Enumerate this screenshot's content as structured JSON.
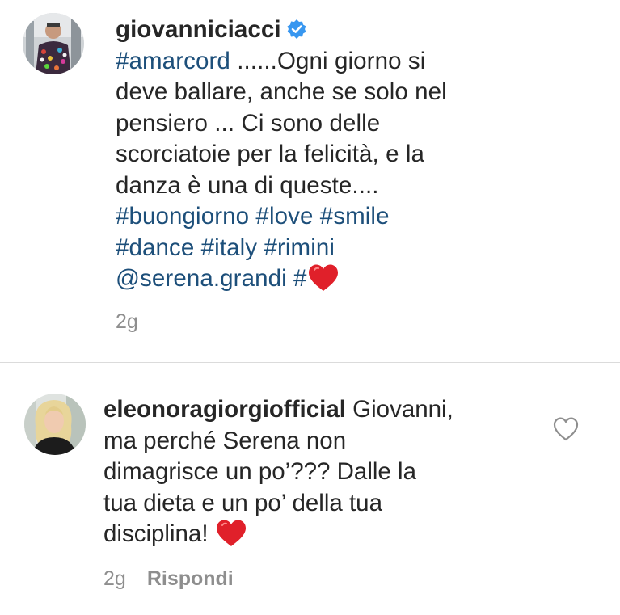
{
  "caption": {
    "username": "giovanniciacci",
    "verified_color": "#3897f0",
    "line1_tag": "#amarcord",
    "line1_rest": " ......Ogni giorno si",
    "line2": "deve ballare, anche se solo nel",
    "line3": "pensiero ... Ci sono delle",
    "line4": "scorciatoie per la felicità, e la",
    "line5": "danza è una di queste....",
    "line6": "#buongiorno #love #smile",
    "line7": "#dance #italy #rimini",
    "line8_mention": "@serena.grandi",
    "line8_tag": " #",
    "heart_icon": "red-heart-emoji",
    "time": "2g"
  },
  "comment": {
    "username": "eleonoragiorgiofficial",
    "line1_rest": " Giovanni,",
    "line2": "ma perché Serena non",
    "line3": "dimagrisce un po’??? Dalle la",
    "line4": "tua dieta e un po’ della tua",
    "line5": "disciplina! ",
    "heart_icon": "red-heart-emoji",
    "time": "2g",
    "reply_label": "Rispondi",
    "like_icon": "heart-outline-icon"
  },
  "colors": {
    "text": "#262626",
    "link": "#1d4f7a",
    "meta": "#8e8e8e",
    "divider": "#dbdbdb",
    "heart": "#e0202a"
  }
}
